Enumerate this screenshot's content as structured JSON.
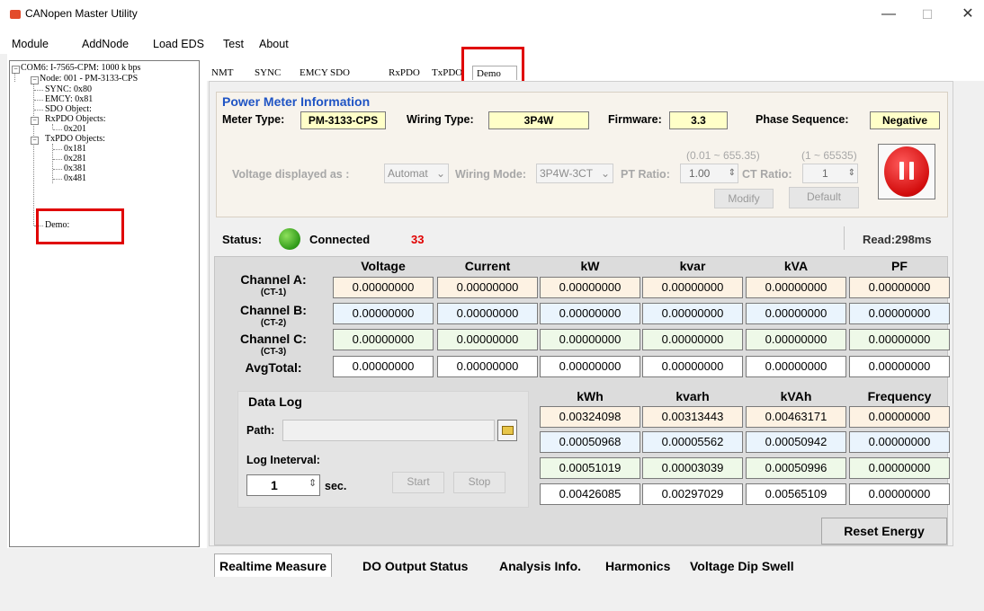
{
  "window": {
    "title": "CANopen Master Utility",
    "app_icon": "canopen-icon",
    "minimize": "—",
    "maximize": "☐",
    "close": "✕"
  },
  "menu": [
    "Module",
    "AddNode",
    "Load EDS",
    "Test",
    "About"
  ],
  "tree": {
    "root": "COM6: I-7565-CPM: 1000 k bps",
    "node": "Node: 001 - PM-3133-CPS",
    "sync": "SYNC: 0x80",
    "emcy": "EMCY: 0x81",
    "sdo": "SDO Object:",
    "rxpdo": "RxPDO Objects:",
    "rxpdo_items": [
      "0x201"
    ],
    "txpdo": "TxPDO Objects:",
    "txpdo_items": [
      "0x181",
      "0x281",
      "0x381",
      "0x481"
    ],
    "demo": "Demo:"
  },
  "top_tabs": [
    "NMT",
    "SYNC",
    "EMCY",
    "SDO",
    "RxPDO",
    "TxPDO",
    "Demo"
  ],
  "power_meter": {
    "title": "Power Meter Information",
    "meter_type_label": "Meter Type:",
    "meter_type": "PM-3133-CPS",
    "wiring_type_label": "Wiring Type:",
    "wiring_type": "3P4W",
    "firmware_label": "Firmware:",
    "firmware": "3.3",
    "phase_label": "Phase Sequence:",
    "phase": "Negative",
    "voltage_label": "Voltage displayed as :",
    "voltage_value": "Automat",
    "wiring_mode_label": "Wiring Mode:",
    "wiring_mode_value": "3P4W-3CT",
    "pt_range": "(0.01 ~ 655.35)",
    "ct_range": "(1 ~ 65535)",
    "pt_label": "PT Ratio:",
    "pt_value": "1.00",
    "ct_label": "CT Ratio:",
    "ct_value": "1",
    "modify": "Modify",
    "default": "Default"
  },
  "status": {
    "label": "Status:",
    "value": "Connected",
    "count": "33",
    "read": "Read:298ms",
    "led_color": "#2f9a18"
  },
  "measure": {
    "columns": [
      "Voltage",
      "Current",
      "kW",
      "kvar",
      "kVA",
      "PF"
    ],
    "rows": [
      {
        "label": "Channel A:",
        "sub": "(CT-1)",
        "values": [
          "0.00000000",
          "0.00000000",
          "0.00000000",
          "0.00000000",
          "0.00000000",
          "0.00000000"
        ]
      },
      {
        "label": "Channel B:",
        "sub": "(CT-2)",
        "values": [
          "0.00000000",
          "0.00000000",
          "0.00000000",
          "0.00000000",
          "0.00000000",
          "0.00000000"
        ]
      },
      {
        "label": "Channel C:",
        "sub": "(CT-3)",
        "values": [
          "0.00000000",
          "0.00000000",
          "0.00000000",
          "0.00000000",
          "0.00000000",
          "0.00000000"
        ]
      },
      {
        "label": "AvgTotal:",
        "sub": "",
        "values": [
          "0.00000000",
          "0.00000000",
          "0.00000000",
          "0.00000000",
          "0.00000000",
          "0.00000000"
        ]
      }
    ],
    "energy_columns": [
      "kWh",
      "kvarh",
      "kVAh",
      "Frequency"
    ],
    "energy_rows": [
      [
        "0.00324098",
        "0.00313443",
        "0.00463171",
        "0.00000000"
      ],
      [
        "0.00050968",
        "0.00005562",
        "0.00050942",
        "0.00000000"
      ],
      [
        "0.00051019",
        "0.00003039",
        "0.00050996",
        "0.00000000"
      ],
      [
        "0.00426085",
        "0.00297029",
        "0.00565109",
        "0.00000000"
      ]
    ]
  },
  "datalog": {
    "title": "Data Log",
    "path_label": "Path:",
    "path_value": "",
    "interval_label": "Log Ineterval:",
    "interval_value": "1",
    "unit": "sec.",
    "start": "Start",
    "stop": "Stop"
  },
  "reset_energy": "Reset Energy",
  "bottom_tabs": [
    "Realtime Measure",
    "DO Output Status",
    "Analysis Info.",
    "Harmonics",
    "Voltage Dip Swell"
  ]
}
